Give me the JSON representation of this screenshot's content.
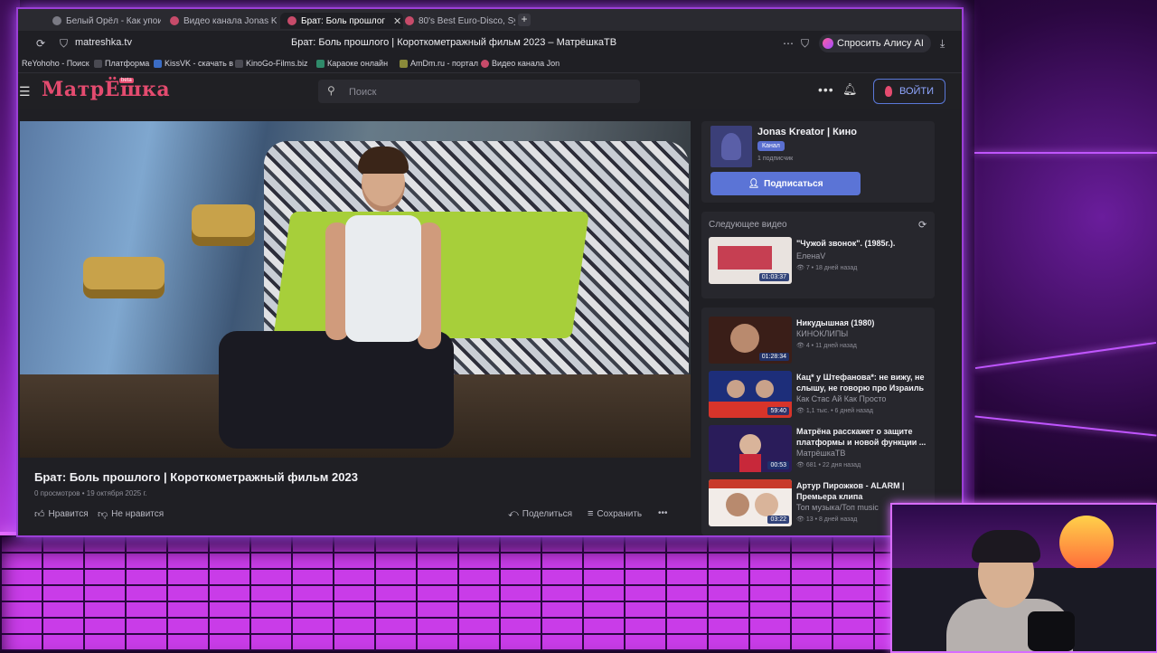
{
  "browser": {
    "tabs": [
      {
        "label": "Белый Орёл - Как упоитель",
        "active": false
      },
      {
        "label": "Видео канала Jonas Kreator",
        "active": false
      },
      {
        "label": "Брат: Боль прошлог",
        "active": true
      },
      {
        "label": "80's Best Euro-Disco, Synth",
        "active": false
      }
    ],
    "url": "matreshka.tv",
    "page_title": "Брат: Боль прошлого | Короткометражный фильм 2023 – МатрёшкаТВ",
    "alice_label": "Спросить Алису AI",
    "bookmarks": [
      "ReYohoho - Поиск",
      "Платформа",
      "KissVK - скачать в",
      "KinoGo-Films.biz",
      "Караоке онлайн",
      "AmDm.ru - портал",
      "Видео канала Jon"
    ]
  },
  "site": {
    "logo": "МатрЁшка",
    "logo_badge": "beta",
    "search_placeholder": "Поиск",
    "login_label": "ВОЙТИ"
  },
  "video": {
    "title": "Брат: Боль прошлого | Короткометражный фильм 2023",
    "views": "0 просмотров",
    "date": "19 октября 2025 г.",
    "like_label": "Нравится",
    "dislike_label": "Не нравится",
    "share_label": "Поделиться",
    "save_label": "Сохранить"
  },
  "channel": {
    "name": "Jonas Kreator | Кино",
    "badge": "Канал",
    "subscribers": "1 подписчик",
    "subscribe_label": "Подписаться"
  },
  "next_video": {
    "heading": "Следующее видео",
    "item": {
      "title": "\"Чужой звонок\". (1985г.).",
      "channel": "ЕленаV",
      "stats": "7 • 18 дней назад",
      "duration": "01:03:37",
      "thumb_color": "#c0223a"
    }
  },
  "recommendations": [
    {
      "title": "Никудышная (1980)",
      "channel": "КИНОКЛИПЫ",
      "stats": "4 • 11 дней назад",
      "duration": "01:28:34",
      "thumb_color": "#6a3a2a"
    },
    {
      "title": "Кац* у Штефанова*: не вижу, не слышу, не говорю про Израиль",
      "channel": "Как Стас Ай Как Просто",
      "stats": "1,1 тыс. • 6 дней назад",
      "duration": "59:40",
      "thumb_color": "#2a4ab0"
    },
    {
      "title": "Матрёна расскажет о защите платформы и новой функции ...",
      "channel": "МатрёшкаТВ",
      "stats": "681 • 22 дня назад",
      "duration": "00:53",
      "thumb_color": "#5a2a8a"
    },
    {
      "title": "Артур Пирожков - ALARM | Премьера клипа",
      "channel": "Топ музыка/Топ music",
      "stats": "13 • 8 дней назад",
      "duration": "03:22",
      "thumb_color": "#c83a2a"
    }
  ],
  "colors": {
    "accent": "#5b74d6",
    "logo": "#e44b6f",
    "frame_neon": "#b34dff"
  }
}
